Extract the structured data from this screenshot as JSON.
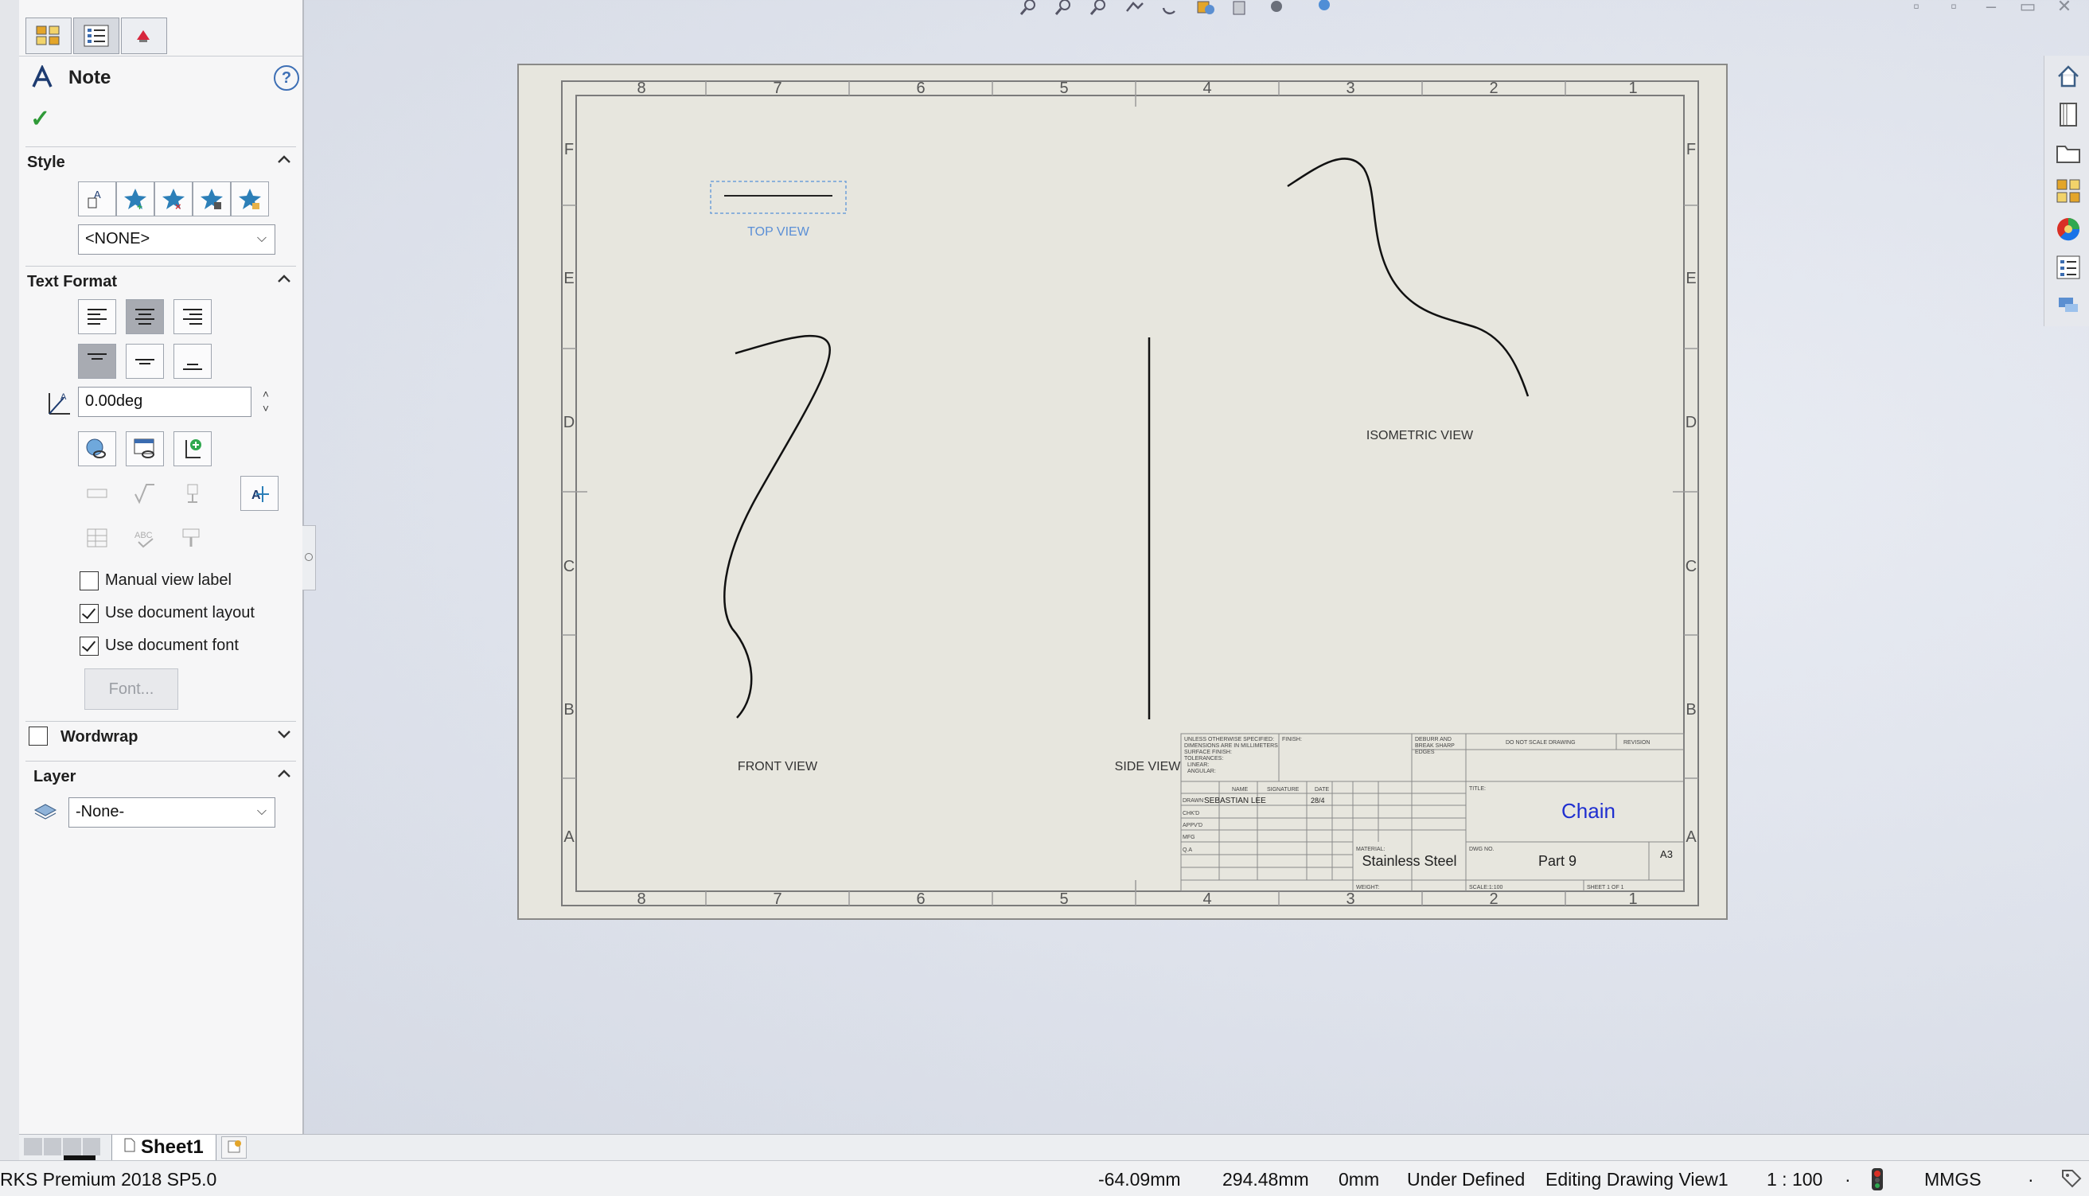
{
  "panel": {
    "title": "Note",
    "sections": {
      "style": "Style",
      "text_format": "Text Format",
      "wordwrap": "Wordwrap",
      "layer": "Layer"
    },
    "style_select": "<NONE>",
    "angle_value": "0.00deg",
    "checkboxes": {
      "manual_view_label": "Manual view label",
      "use_document_layout": "Use document layout",
      "use_document_font": "Use document font"
    },
    "font_button": "Font...",
    "layer_select": "-None-"
  },
  "sheet": {
    "col_labels": [
      "8",
      "7",
      "6",
      "5",
      "4",
      "3",
      "2",
      "1"
    ],
    "row_labels": [
      "F",
      "E",
      "D",
      "C",
      "B",
      "A"
    ],
    "views": {
      "top": "TOP VIEW",
      "front": "FRONT VIEW",
      "side": "SIDE VIEW",
      "isometric": "ISOMETRIC VIEW"
    },
    "title_block": {
      "title": "Chain",
      "material": "Stainless Steel",
      "dwg_no": "Part 9",
      "size": "A3",
      "drawn_by": "SEBASTIAN LEE",
      "date": "28/4",
      "notes_left": [
        "UNLESS OTHERWISE SPECIFIED:",
        "DIMENSIONS ARE IN MILLIMETERS",
        "SURFACE FINISH:",
        "TOLERANCES:",
        "LINEAR:",
        "ANGULAR:"
      ],
      "finish": "FINISH:",
      "deburr": [
        "DEBURR AND",
        "BREAK SHARP",
        "EDGES"
      ],
      "do_not_scale": "DO NOT SCALE DRAWING",
      "revision": "REVISION",
      "name_hdr": "NAME",
      "signature_hdr": "SIGNATURE",
      "date_hdr": "DATE",
      "rows": [
        "DRAWN",
        "CHK'D",
        "APPV'D",
        "MFG",
        "Q.A"
      ],
      "title_hdr": "TITLE:",
      "material_hdr": "MATERIAL:",
      "dwg_hdr": "DWG NO.",
      "weight_hdr": "WEIGHT:",
      "scale": "SCALE:1:100",
      "sheet_of": "SHEET 1 OF 1"
    }
  },
  "sheet_tab": "Sheet1",
  "status": {
    "product": "RKS Premium 2018 SP5.0",
    "x": "-64.09mm",
    "y": "294.48mm",
    "z": "0mm",
    "state": "Under Defined",
    "editing": "Editing Drawing View1",
    "scale": "1 : 100",
    "units": "MMGS"
  },
  "colors": {
    "title_blue": "#1f2fd0",
    "view_label_blue": "#5a8fd6",
    "ok_green": "#2f9a38"
  }
}
